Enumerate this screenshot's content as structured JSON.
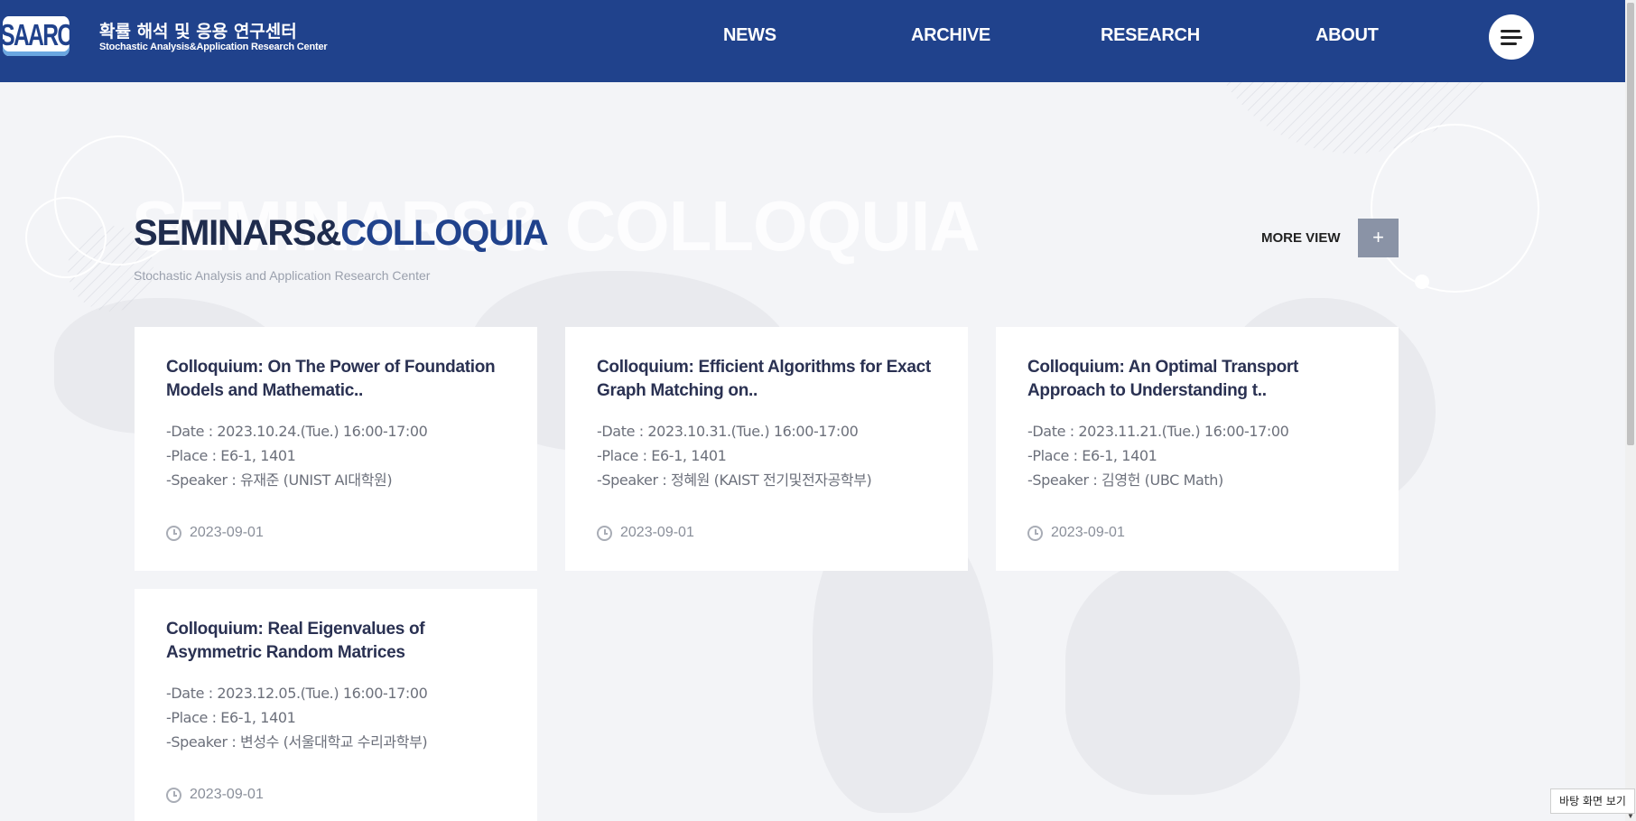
{
  "header": {
    "logo_text": "SAARC",
    "brand_ko": "확률 해석 및 응용 연구센터",
    "brand_en": "Stochastic Analysis&Application Research Center",
    "nav": [
      "NEWS",
      "ARCHIVE",
      "RESEARCH",
      "ABOUT"
    ],
    "menu_icon": "hamburger-icon"
  },
  "section": {
    "bg_title": "SEMINARS& COLLOQUIA",
    "title_part1": "SEMINARS&",
    "title_part2": "COLLOQUIA",
    "subtitle": "Stochastic Analysis and Application Research Center",
    "more_label": "MORE VIEW",
    "more_icon": "+"
  },
  "cards": [
    {
      "title": "Colloquium: On The Power of Foundation Models and Mathematic..",
      "date": "-Date : 2023.10.24.(Tue.) 16:00-17:00",
      "place": "-Place : E6-1, 1401",
      "speaker": "-Speaker : 유재준 (UNIST AI대학원)",
      "posted": "2023-09-01"
    },
    {
      "title": "Colloquium: Efficient Algorithms for Exact Graph Matching on..",
      "date": "-Date : 2023.10.31.(Tue.) 16:00-17:00",
      "place": "-Place : E6-1, 1401",
      "speaker": "-Speaker : 정혜원 (KAIST 전기및전자공학부)",
      "posted": "2023-09-01"
    },
    {
      "title": "Colloquium: An Optimal Transport Approach to Understanding t..",
      "date": "-Date : 2023.11.21.(Tue.) 16:00-17:00",
      "place": "-Place : E6-1, 1401",
      "speaker": "-Speaker : 김영헌 (UBC Math)",
      "posted": "2023-09-01"
    },
    {
      "title": "Colloquium: Real Eigenvalues of Asymmetric Random Matrices",
      "date": "-Date : 2023.12.05.(Tue.) 16:00-17:00",
      "place": "-Place : E6-1, 1401",
      "speaker": "-Speaker : 변성수 (서울대학교 수리과학부)",
      "posted": "2023-09-01"
    }
  ],
  "tooltip": "바탕 화면 보기",
  "colors": {
    "header_bg": "#20428c",
    "title_dark": "#1f2c4d",
    "title_accent": "#20428c",
    "more_button": "#8a93a6",
    "page_bg": "#f3f4f7"
  }
}
